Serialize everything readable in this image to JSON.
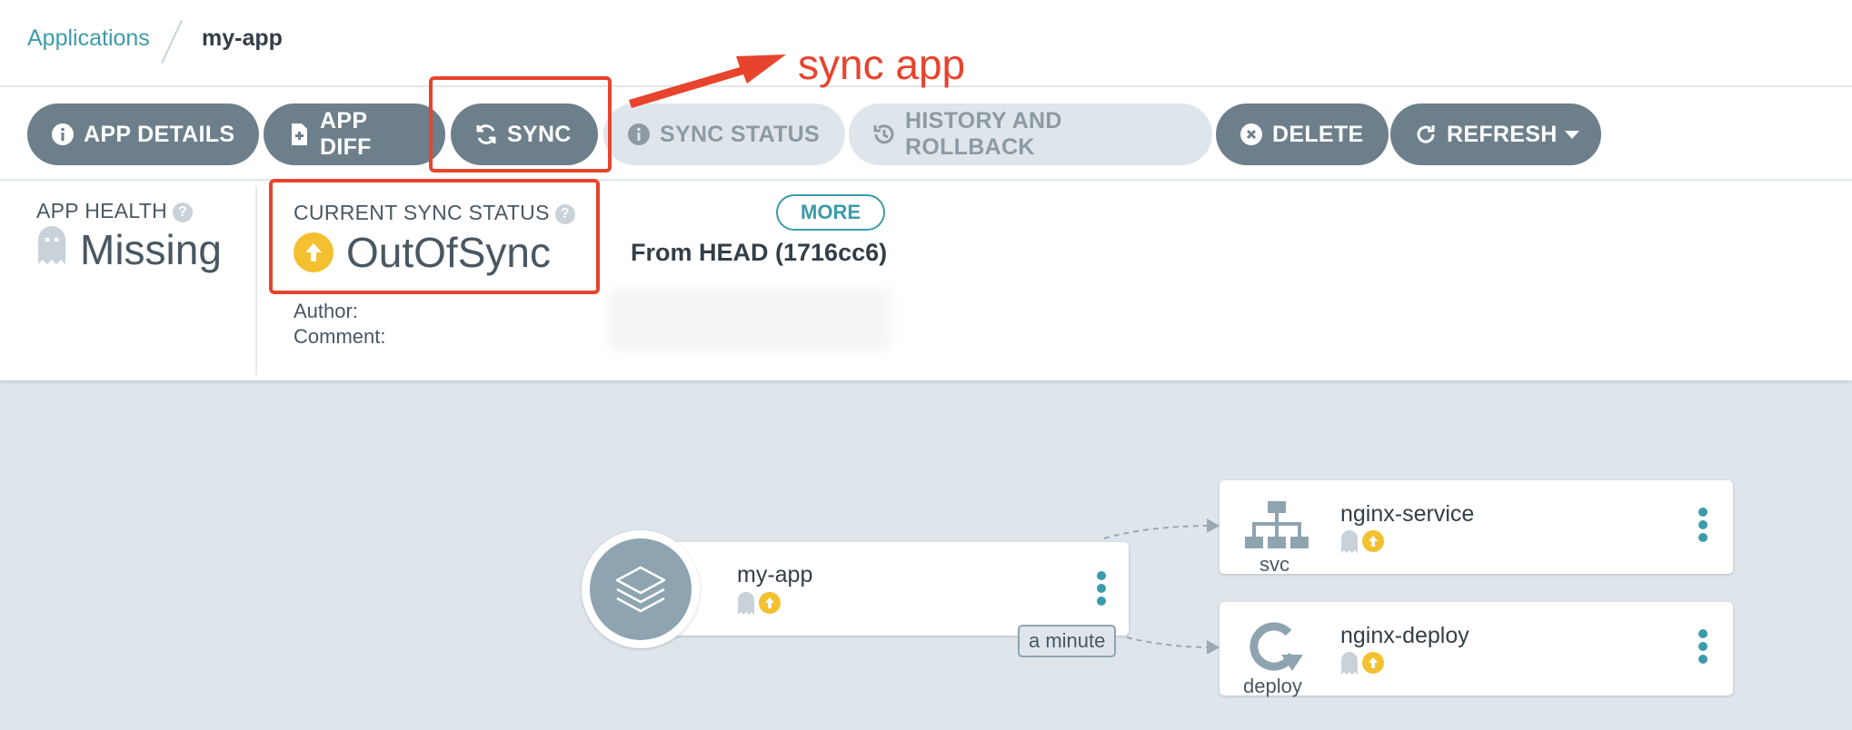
{
  "breadcrumb": {
    "parent": "Applications",
    "current": "my-app"
  },
  "toolbar": {
    "app_details": "APP DETAILS",
    "app_diff": "APP DIFF",
    "sync": "SYNC",
    "sync_status": "SYNC STATUS",
    "history": "HISTORY AND ROLLBACK",
    "delete": "DELETE",
    "refresh": "REFRESH"
  },
  "status": {
    "health_label": "APP HEALTH",
    "health_value": "Missing",
    "sync_label": "CURRENT SYNC STATUS",
    "sync_value": "OutOfSync",
    "more_label": "MORE",
    "revision": "From HEAD (1716cc6)",
    "author_label": "Author:",
    "comment_label": "Comment:"
  },
  "annotation": {
    "text": "sync app",
    "color": "#e8432d"
  },
  "graph": {
    "app": {
      "name": "my-app"
    },
    "time_tag": "a minute",
    "service": {
      "name": "nginx-service",
      "kind": "svc"
    },
    "deploy": {
      "name": "nginx-deploy",
      "kind": "deploy"
    }
  },
  "colors": {
    "accent": "#3b9bab",
    "out_of_sync": "#f4c030",
    "button": "#6d7f8b"
  }
}
